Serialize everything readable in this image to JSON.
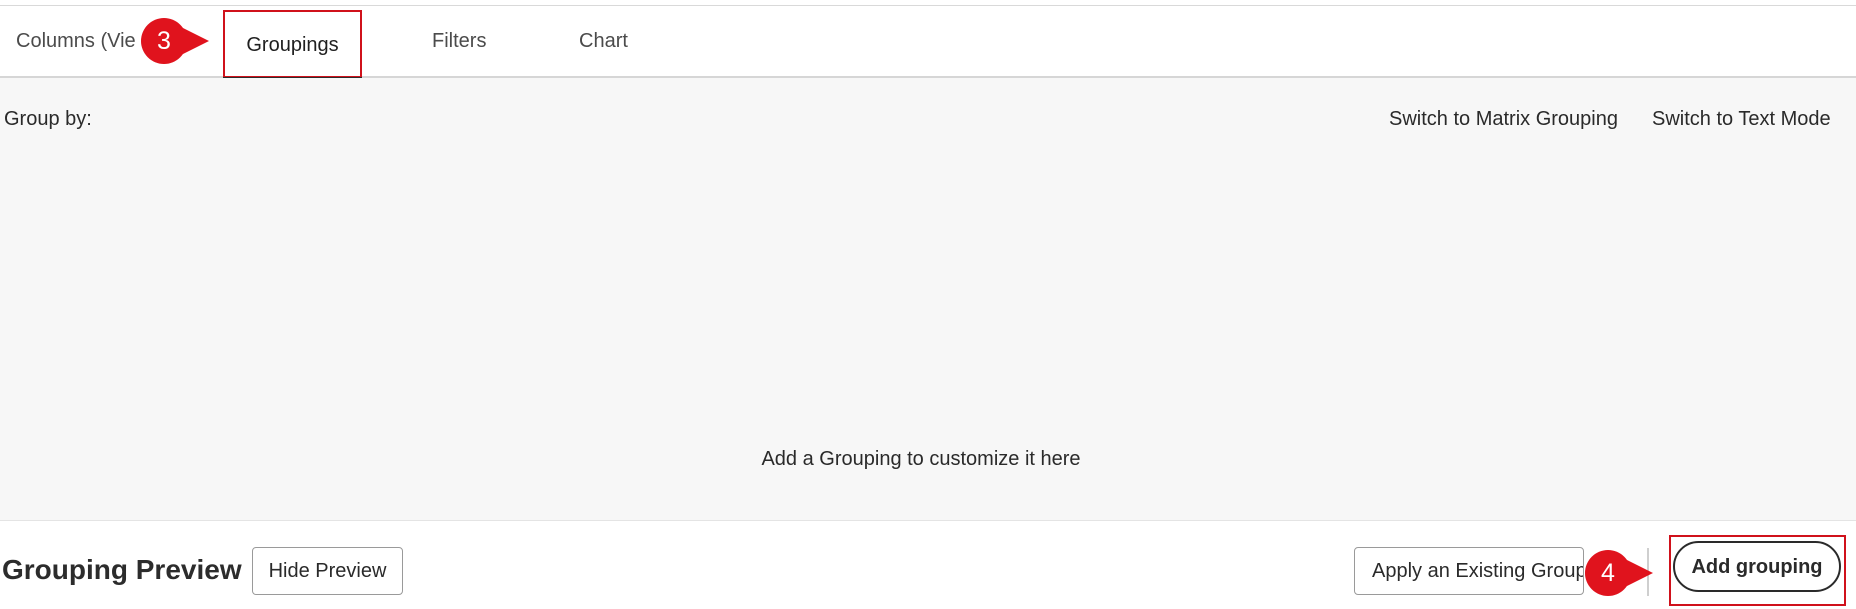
{
  "tabs": [
    {
      "label": "Columns (Vie"
    },
    {
      "label": "Groupings"
    },
    {
      "label": "Filters"
    },
    {
      "label": "Chart"
    }
  ],
  "callouts": {
    "step3": "3",
    "step4": "4"
  },
  "panel": {
    "group_by_label": "Group by:",
    "switch_matrix_label": "Switch to Matrix Grouping",
    "switch_text_label": "Switch to Text Mode",
    "empty_message": "Add a Grouping to customize it here"
  },
  "footer": {
    "preview_title": "Grouping Preview",
    "hide_preview_label": "Hide Preview",
    "apply_existing_label": "Apply an Existing Group",
    "add_grouping_label": "Add grouping"
  },
  "colors": {
    "accent": "#e0131d",
    "highlight": "#d0111b",
    "panel_bg": "#f7f7f7"
  }
}
